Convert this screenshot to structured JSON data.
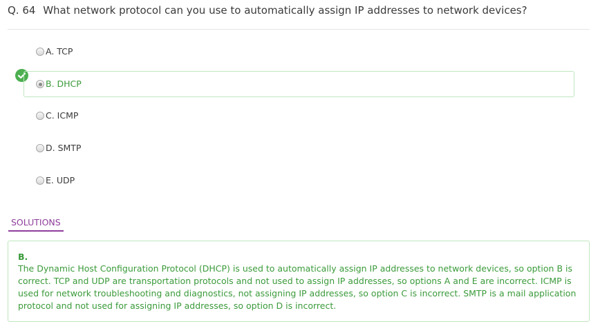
{
  "question": {
    "number": "Q. 64",
    "text": "What network protocol can you use to automatically assign IP addresses to network devices?"
  },
  "options": [
    {
      "label": "A. TCP",
      "selected": false,
      "correct": false
    },
    {
      "label": "B. DHCP",
      "selected": true,
      "correct": true
    },
    {
      "label": "C. ICMP",
      "selected": false,
      "correct": false
    },
    {
      "label": "D. SMTP",
      "selected": false,
      "correct": false
    },
    {
      "label": "E. UDP",
      "selected": false,
      "correct": false
    }
  ],
  "solutions": {
    "tab_label": "SOLUTIONS",
    "answer": "B.",
    "explanation": "The Dynamic Host Configuration Protocol (DHCP) is used to automatically assign IP addresses to network devices, so option B is correct. TCP and UDP are transportation protocols and not used to assign IP addresses, so options A and E are incorrect. ICMP is used for network troubleshooting and diagnostics, not assigning IP addresses, so option C is incorrect. SMTP is a mail application protocol and not used for assigning IP addresses, so option D is incorrect."
  },
  "colors": {
    "correct_green": "#3a9a3a",
    "correct_border": "#bfe6bf",
    "accent_purple": "#8e3d9b",
    "text": "#3a3a3a"
  },
  "icons": {
    "correct_badge": "check-circle-icon"
  }
}
